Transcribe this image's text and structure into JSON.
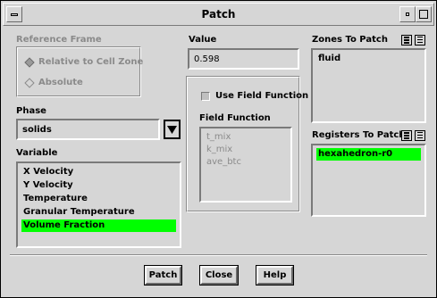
{
  "window": {
    "title": "Patch"
  },
  "reference_frame": {
    "label": "Reference Frame",
    "options": [
      {
        "label": "Relative to Cell Zone",
        "selected": true
      },
      {
        "label": "Absolute",
        "selected": false
      }
    ]
  },
  "phase": {
    "label": "Phase",
    "value": "solids"
  },
  "variable": {
    "label": "Variable",
    "items": [
      "X Velocity",
      "Y Velocity",
      "Temperature",
      "Granular Temperature",
      "Volume Fraction"
    ],
    "selected_index": 4
  },
  "value": {
    "label": "Value",
    "current": "0.598"
  },
  "field_function": {
    "checkbox_label": "Use Field Function",
    "list_label": "Field Function",
    "items": [
      "t_mix",
      "k_mix",
      "ave_btc"
    ]
  },
  "zones": {
    "label": "Zones To Patch",
    "items": [
      "fluid"
    ]
  },
  "registers": {
    "label": "Registers To Patch",
    "items": [
      "hexahedron-r0"
    ],
    "selected_index": 0
  },
  "buttons": {
    "patch": "Patch",
    "close": "Close",
    "help": "Help"
  },
  "colors": {
    "selection": "#00ff00",
    "background": "#d6d6d6"
  }
}
